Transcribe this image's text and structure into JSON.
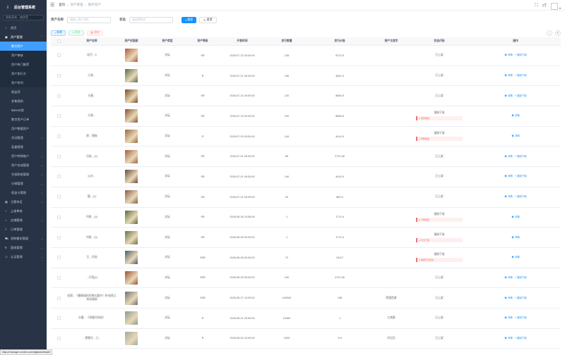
{
  "app": {
    "title": "后台管理系统",
    "search_placeholder": "搜索菜单、按拼音",
    "status_url": "https://manager.urvdev.com/digitasset/asset"
  },
  "sidebar": {
    "items": [
      {
        "label": "首页",
        "kind": "top",
        "icon": "home"
      },
      {
        "label": "资产管理",
        "kind": "top-open",
        "icon": "folder",
        "arrow": "⌃"
      },
      {
        "label": "数字资产",
        "kind": "active"
      },
      {
        "label": "资产审核",
        "kind": "sub"
      },
      {
        "label": "资产热门推荐",
        "kind": "sub"
      },
      {
        "label": "资产发行方",
        "kind": "sub"
      },
      {
        "label": "资产系列",
        "kind": "sub"
      },
      {
        "label": "权益项",
        "kind": "plain"
      },
      {
        "label": "发售规则",
        "kind": "plain"
      },
      {
        "label": "Banner图",
        "kind": "plain"
      },
      {
        "label": "数字资产订单",
        "kind": "plain"
      },
      {
        "label": "用户数据资产",
        "kind": "plain"
      },
      {
        "label": "活动管理",
        "kind": "plain",
        "arrow": "⌄"
      },
      {
        "label": "盲盒管理",
        "kind": "plain"
      },
      {
        "label": "资产转移账户",
        "kind": "plain",
        "arrow": "⌄"
      },
      {
        "label": "资产合成管理",
        "kind": "plain",
        "arrow": "⌄"
      },
      {
        "label": "空投和抢管理",
        "kind": "plain",
        "arrow": "⌄"
      },
      {
        "label": "分销管理",
        "kind": "plain",
        "arrow": "⌄"
      },
      {
        "label": "权益卡管理",
        "kind": "plain",
        "arrow": "⌄"
      },
      {
        "label": "主题市区",
        "kind": "top",
        "icon": "grid",
        "arrow": "⌄"
      },
      {
        "label": "上架审核",
        "kind": "top",
        "icon": "check"
      },
      {
        "label": "店铺管理",
        "kind": "top",
        "icon": "shop",
        "arrow": "⌄"
      },
      {
        "label": "订单管理",
        "kind": "top",
        "icon": "list"
      },
      {
        "label": "采购需求管理",
        "kind": "top",
        "icon": "cart",
        "arrow": "⌄"
      },
      {
        "label": "盈收管理",
        "kind": "top",
        "icon": "coin",
        "arrow": "⌄"
      },
      {
        "label": "认证管理",
        "kind": "top",
        "icon": "user",
        "arrow": "⌄"
      }
    ]
  },
  "breadcrumb": [
    "首页",
    "资产管理",
    "数字资产"
  ],
  "filters": {
    "name_label": "资产名称",
    "name_placeholder": "请输入资产名称",
    "status_label": "状态",
    "status_placeholder": "请选择状态",
    "search_btn": "搜索",
    "reset_btn": "重置"
  },
  "toolbar": {
    "add": "新增",
    "edit": "修改",
    "delete": "删除"
  },
  "table": {
    "headers": [
      "",
      "资产名称",
      "资产封面图",
      "资产类型",
      "资产等级",
      "开售时间",
      "发行数量",
      "发行价格",
      "资产文保字",
      "状态代码",
      "操作"
    ],
    "rows": [
      {
        "name": "花开…5",
        "type": "文玩",
        "level": "SR",
        "time": "2026-07-22 00:00:00",
        "qty": "128",
        "price": "8710.5",
        "code": "",
        "state": "已上架",
        "alert": "",
        "ops": [
          "详情",
          "强制下架"
        ],
        "cover": "#b05a3a"
      },
      {
        "name": "江南…",
        "type": "文玩",
        "level": "R",
        "time": "2026-07-21 00:00:00",
        "qty": "136",
        "price": "4651.5",
        "code": "",
        "state": "已上架",
        "alert": "",
        "ops": [
          "详情",
          "强制下架"
        ],
        "cover": "#556b4a"
      },
      {
        "name": "大唐…",
        "type": "文玩",
        "level": "SR",
        "time": "2026-07-21 00:00:00",
        "qty": "120",
        "price": "8656.5",
        "code": "",
        "state": "已上架",
        "alert": "",
        "ops": [
          "详情",
          "强制下架"
        ],
        "cover": "#7a4a2a"
      },
      {
        "name": "大漠…",
        "type": "文玩",
        "level": "SR",
        "time": "2026-07-15 00:00:00",
        "qty": "120",
        "price": "8656.5",
        "code": "",
        "state": "强制下架",
        "alert": "自营降级",
        "ops": [
          "详情"
        ],
        "cover": "#8a5030"
      },
      {
        "name": "醉…雪梅",
        "type": "文玩",
        "level": "R",
        "time": "2026-07-03 00:00:00",
        "qty": "144",
        "price": "4414.5",
        "code": "",
        "state": "强制下架",
        "alert": "调整数量",
        "ops": [
          "详情"
        ],
        "cover": "#9a6a3a"
      },
      {
        "name": "古韵…(2)",
        "type": "文玩",
        "level": "SR",
        "time": "2026-07-01 00:00:00",
        "qty": "89",
        "price": "2721.06",
        "code": "",
        "state": "已上架",
        "alert": "",
        "ops": [
          "详情",
          "强制下架"
        ],
        "cover": "#a06040"
      },
      {
        "name": "山水…",
        "type": "文玩",
        "level": "SR",
        "time": "2026-07-01 00:00:00",
        "qty": "140",
        "price": "4414.5",
        "code": "",
        "state": "已上架",
        "alert": "",
        "ops": [
          "详情",
          "强制下架"
        ],
        "cover": "#6a4a3a"
      },
      {
        "name": "霜…(2)",
        "type": "文玩",
        "level": "SR",
        "time": "2026-07-01 00:00:00",
        "qty": "20",
        "price": "882.9",
        "code": "",
        "state": "已上架",
        "alert": "",
        "ops": [
          "详情",
          "强制下架"
        ],
        "cover": "#8a5a40"
      },
      {
        "name": "竹影…(3)",
        "type": "文玩",
        "level": "SR",
        "time": "2026-06-26 10:36:39",
        "qty": "1",
        "price": "1774.4",
        "code": "",
        "state": "强制下架",
        "alert": "订单错误",
        "ops": [
          "详情"
        ],
        "cover": "#5a6a3a"
      },
      {
        "name": "竹影…(3)",
        "type": "文玩",
        "level": "SR",
        "time": "2026-06-26 00:00:00",
        "qty": "1",
        "price": "1774.4",
        "code": "",
        "state": "强制下架",
        "alert": "无法下架",
        "ops": [
          "详情"
        ],
        "cover": "#6a7040"
      },
      {
        "name": "玉…玲珑",
        "type": "文玩",
        "level": "SSR",
        "time": "2026-06-25 00:00:00",
        "qty": "72",
        "price": "15117",
        "code": "",
        "state": "强制下架",
        "alert": "数据不可用态",
        "ops": [
          "详情"
        ],
        "cover": "#4a5a6a"
      },
      {
        "name": "…灯笼(2)",
        "type": "文玩",
        "level": "SSR",
        "time": "2026-06-25 00:00:00",
        "qty": "100",
        "price": "2721.06",
        "code": "",
        "state": "已上架",
        "alert": "",
        "ops": [
          "详情",
          "强制下架"
        ],
        "cover": "#9a5030"
      },
      {
        "name": "张国…《最美丽的世博大嘉年》钟 秘密之地动画版",
        "type": "文玩",
        "level": "SSR",
        "time": "2026-05-27 10:00:00",
        "qty": "100000",
        "price": "198",
        "code": "西国西游",
        "state": "已上架",
        "alert": "",
        "ops": [
          "详情",
          "强制下架"
        ],
        "cover": "#707070"
      },
      {
        "name": "水墨…《荷塘月色绘》",
        "type": "文玩",
        "level": "R",
        "time": "2026-05-21 20:30:00",
        "qty": "10000",
        "price": "1",
        "code": "江南客",
        "state": "已上架",
        "alert": "",
        "ops": [
          "详情",
          "强制下架"
        ],
        "cover": "#8a9a8a"
      },
      {
        "name": "…素雅月…之…",
        "type": "文玩",
        "level": "R",
        "time": "2026-05-02 10:00:00",
        "qty": "1000",
        "price": "9.9",
        "code": "印记文",
        "state": "已上架",
        "alert": "",
        "ops": [
          "详情",
          "强制下架"
        ],
        "cover": "#a0a8a0"
      }
    ]
  }
}
